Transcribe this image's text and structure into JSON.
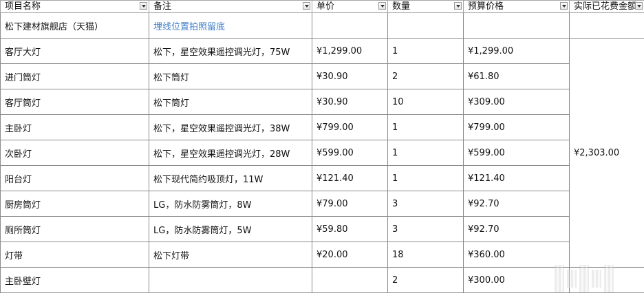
{
  "headers": [
    "项目名称",
    "备注",
    "单价",
    "数量",
    "预算价格",
    "实际已花费金额"
  ],
  "store_row": {
    "name": "松下建材旗舰店（天猫）",
    "note": "埋线位置拍照留底"
  },
  "rows": [
    {
      "name": "客厅大灯",
      "note": "松下，星空效果遥控调光灯，75W",
      "price": "¥1,299.00",
      "qty": "1",
      "budget": "¥1,299.00"
    },
    {
      "name": "进门筒灯",
      "note": "松下筒灯",
      "price": "¥30.90",
      "qty": "2",
      "budget": "¥61.80"
    },
    {
      "name": "客厅筒灯",
      "note": "松下筒灯",
      "price": "¥30.90",
      "qty": "10",
      "budget": "¥309.00"
    },
    {
      "name": "主卧灯",
      "note": "松下，星空效果遥控调光灯，38W",
      "price": "¥799.00",
      "qty": "1",
      "budget": "¥799.00"
    },
    {
      "name": "次卧灯",
      "note": "松下，星空效果遥控调光灯，28W",
      "price": "¥599.00",
      "qty": "1",
      "budget": "¥599.00"
    },
    {
      "name": "阳台灯",
      "note": "松下现代简约吸顶灯，11W",
      "price": "¥121.40",
      "qty": "1",
      "budget": "¥121.40"
    },
    {
      "name": "厨房筒灯",
      "note": "LG，防水防雾筒灯，8W",
      "price": "¥79.00",
      "qty": "3",
      "budget": "¥92.70"
    },
    {
      "name": "厕所筒灯",
      "note": "LG，防水防雾筒灯，5W",
      "price": "¥59.80",
      "qty": "3",
      "budget": "¥92.70"
    },
    {
      "name": "灯带",
      "note": "松下灯带",
      "price": "¥20.00",
      "qty": "18",
      "budget": "¥360.00"
    },
    {
      "name": "主卧壁灯",
      "note": "",
      "price": "",
      "qty": "2",
      "budget": "¥300.00"
    }
  ],
  "actual_spent_total": "¥2,303.00",
  "colors": {
    "link": "#3e7cc8",
    "grid": "#8a8a8a"
  }
}
